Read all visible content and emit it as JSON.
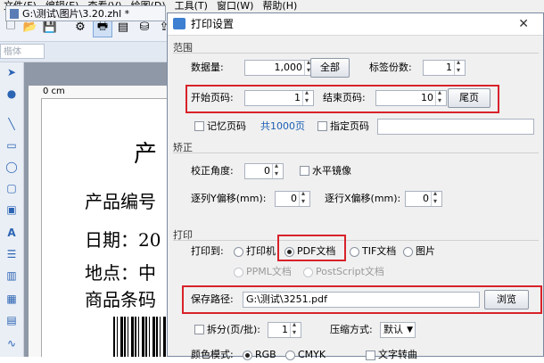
{
  "menu": [
    "文件(F)",
    "编辑(E)",
    "查看(V)",
    "绘图(D)",
    "工具(T)",
    "窗口(W)",
    "帮助(H)"
  ],
  "font_box": "楷体",
  "doc_tab": "G:\\测试\\图片\\3.20.zhl *",
  "ruler_label": "0 cm",
  "paper_lines": [
    "产",
    "产品编号",
    "日期：20",
    "地点：中",
    "商品条码"
  ],
  "dialog": {
    "title": "打印设置",
    "close": "✕",
    "range": {
      "label": "范围",
      "data_qty_label": "数据量:",
      "data_qty": "1,000",
      "all_button": "全部",
      "copies_label": "标签份数:",
      "copies": "1",
      "start_label": "开始页码:",
      "start": "1",
      "end_label": "结束页码:",
      "end": "10",
      "last_button": "尾页",
      "remember_label": "记忆页码",
      "total_label": "共1000页",
      "specify_label": "指定页码"
    },
    "correction": {
      "label": "矫正",
      "angle_label": "校正角度:",
      "angle": "0",
      "mirror_label": "水平镜像",
      "y_offset_label": "逐列Y偏移(mm):",
      "y_offset": "0",
      "x_offset_label": "逐行X偏移(mm):",
      "x_offset": "0"
    },
    "print": {
      "label": "打印",
      "print_to_label": "打印到:",
      "options": [
        "打印机",
        "PDF文档",
        "TIF文档",
        "图片"
      ],
      "disabled_options": [
        "PPML文档",
        "PostScript文档"
      ],
      "save_path_label": "保存路径:",
      "save_path": "G:\\测试\\3251.pdf",
      "browse_button": "浏览",
      "split_label": "拆分(页/批):",
      "split_value": "1",
      "compress_label": "压缩方式:",
      "compress_value": "默认",
      "color_label": "颜色模式:",
      "color_options": [
        "RGB",
        "CMYK"
      ],
      "text_outline_label": "文字转曲"
    }
  },
  "colors": {
    "highlight": "#d8222a",
    "link": "#1a5fb4"
  }
}
